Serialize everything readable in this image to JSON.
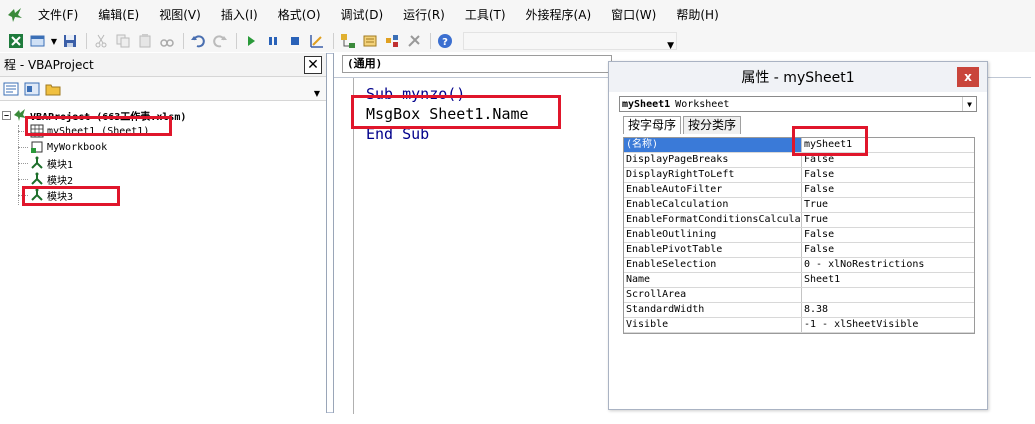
{
  "menu": {
    "items": [
      "文件(F)",
      "编辑(E)",
      "视图(V)",
      "插入(I)",
      "格式(O)",
      "调试(D)",
      "运行(R)",
      "工具(T)",
      "外接程序(A)",
      "窗口(W)",
      "帮助(H)"
    ]
  },
  "toolbar": {
    "icons": [
      "excel-icon",
      "insert-userform-icon",
      "save-icon",
      "cut-icon",
      "copy-icon",
      "paste-icon",
      "find-icon",
      "undo-icon",
      "redo-icon",
      "run-icon",
      "pause-icon",
      "stop-icon",
      "design-mode-icon",
      "project-explorer-icon",
      "properties-icon",
      "object-browser-icon",
      "toolbox-icon",
      "help-icon"
    ]
  },
  "project": {
    "title": "程 - VBAProject",
    "close_label": "✕",
    "root_label": "VBAProject (663工作表.xlsm)",
    "items": [
      {
        "label": "mySheet1 (Sheet1)",
        "icon": "worksheet-icon"
      },
      {
        "label": "MyWorkbook",
        "icon": "workbook-icon"
      },
      {
        "label": "模块1",
        "icon": "module-icon"
      },
      {
        "label": "模块2",
        "icon": "module-icon"
      },
      {
        "label": "模块3",
        "icon": "module-icon"
      }
    ]
  },
  "code": {
    "object_combo": "(通用)",
    "lines": [
      "Sub mynzo()",
      "MsgBox Sheet1.Name",
      "End Sub"
    ]
  },
  "properties": {
    "title": "属性 - mySheet1",
    "close_label": "x",
    "object_combo": "mySheet1 Worksheet",
    "object_name": "mySheet1",
    "object_type": "Worksheet",
    "tabs": [
      "按字母序",
      "按分类序"
    ],
    "rows": [
      {
        "key": "(名称)",
        "value": "mySheet1"
      },
      {
        "key": "DisplayPageBreaks",
        "value": "False"
      },
      {
        "key": "DisplayRightToLeft",
        "value": "False"
      },
      {
        "key": "EnableAutoFilter",
        "value": "False"
      },
      {
        "key": "EnableCalculation",
        "value": "True"
      },
      {
        "key": "EnableFormatConditionsCalculation",
        "value": "True"
      },
      {
        "key": "EnableOutlining",
        "value": "False"
      },
      {
        "key": "EnablePivotTable",
        "value": "False"
      },
      {
        "key": "EnableSelection",
        "value": "0 - xlNoRestrictions"
      },
      {
        "key": "Name",
        "value": "Sheet1"
      },
      {
        "key": "ScrollArea",
        "value": ""
      },
      {
        "key": "StandardWidth",
        "value": "8.38"
      },
      {
        "key": "Visible",
        "value": "-1 - xlSheetVisible"
      }
    ]
  },
  "colors": {
    "highlight": "#e0162b",
    "code_keyword": "#00008b",
    "selection": "#3a7ad8",
    "close_button": "#c9453b"
  }
}
